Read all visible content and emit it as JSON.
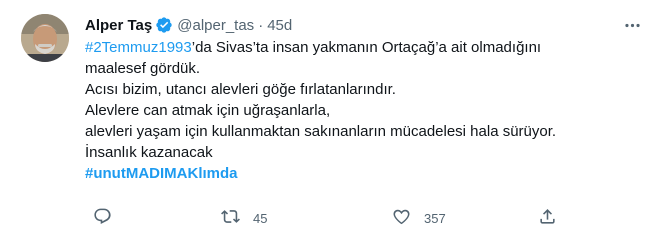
{
  "tweet": {
    "author_name": "Alper Taş",
    "handle": "@alper_tas",
    "separator": "·",
    "time": "45d",
    "text": {
      "line1_hashtag": "#2Temmuz1993",
      "line1_rest": "’da Sivas’ta insan yakmanın Ortaçağ’a ait olmadığını",
      "line2": "maalesef gördük.",
      "line3": "Acısı bizim, utancı alevleri göğe fırlatanlarındır.",
      "line4": "Alevlere can atmak için uğraşanlarla,",
      "line5": "alevleri yaşam için kullanmaktan sakınanların mücadelesi hala sürüyor.",
      "line6": "İnsanlık kazanacak",
      "line7_hashtag": "#unutMADIMAKlımda"
    },
    "actions": {
      "reply_count": "",
      "retweet_count": "45",
      "like_count": "357",
      "share_count": ""
    },
    "icons": {
      "verified": "verified-badge-icon",
      "more": "more-icon",
      "reply": "reply-icon",
      "retweet": "retweet-icon",
      "like": "like-icon",
      "share": "share-icon"
    },
    "colors": {
      "accent": "#1d9bf0",
      "secondary_text": "#536471",
      "primary_text": "#0f1419"
    }
  }
}
